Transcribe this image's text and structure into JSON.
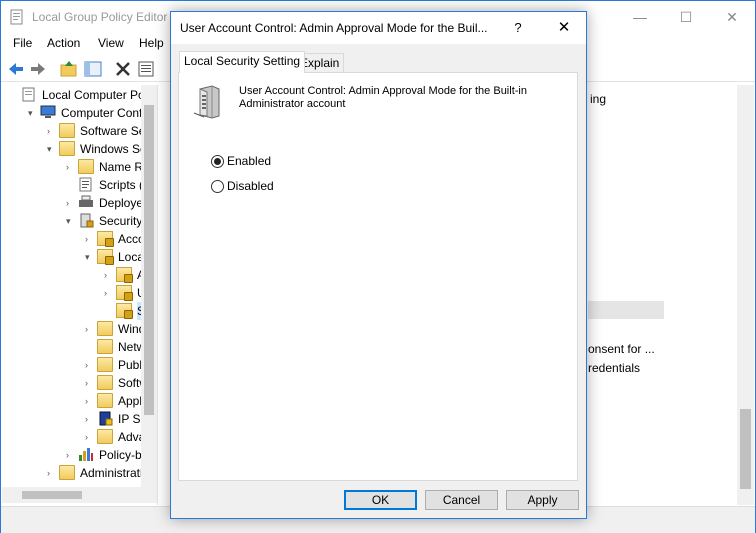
{
  "background_window": {
    "title": "Local Group Policy Editor",
    "controls": {
      "minimize": "—",
      "maximize": "☐",
      "close": "✕"
    },
    "menu": [
      "File",
      "Action",
      "View",
      "Help"
    ],
    "tree": [
      {
        "label": "Local Computer Polic",
        "indent": 0,
        "expander": "",
        "icon": "computer-policy-icon"
      },
      {
        "label": "Computer Config",
        "indent": 1,
        "expander": "▾",
        "icon": "computer-icon"
      },
      {
        "label": "Software Setti",
        "indent": 2,
        "expander": "›",
        "icon": "folder-icon"
      },
      {
        "label": "Windows Sett",
        "indent": 2,
        "expander": "▾",
        "icon": "folder-icon"
      },
      {
        "label": "Name Res",
        "indent": 3,
        "expander": "›",
        "icon": "folder-icon"
      },
      {
        "label": "Scripts (Sta",
        "indent": 3,
        "expander": "",
        "icon": "scripts-icon"
      },
      {
        "label": "Deployed",
        "indent": 3,
        "expander": "›",
        "icon": "printer-icon"
      },
      {
        "label": "Security Se",
        "indent": 3,
        "expander": "▾",
        "icon": "security-icon"
      },
      {
        "label": "Accou",
        "indent": 4,
        "expander": "›",
        "icon": "folder-lock-icon"
      },
      {
        "label": "Local P",
        "indent": 4,
        "expander": "▾",
        "icon": "folder-lock-icon"
      },
      {
        "label": "Au",
        "indent": 5,
        "expander": "›",
        "icon": "folder-lock-icon"
      },
      {
        "label": "Use",
        "indent": 5,
        "expander": "›",
        "icon": "folder-lock-icon"
      },
      {
        "label": "Sec",
        "indent": 5,
        "expander": "",
        "icon": "folder-lock-icon",
        "selected": true
      },
      {
        "label": "Windo",
        "indent": 4,
        "expander": "›",
        "icon": "folder-icon"
      },
      {
        "label": "Netwo",
        "indent": 4,
        "expander": "",
        "icon": "folder-icon"
      },
      {
        "label": "Public",
        "indent": 4,
        "expander": "›",
        "icon": "folder-icon"
      },
      {
        "label": "Softwa",
        "indent": 4,
        "expander": "›",
        "icon": "folder-icon"
      },
      {
        "label": "Applic",
        "indent": 4,
        "expander": "›",
        "icon": "folder-icon"
      },
      {
        "label": "IP Secu",
        "indent": 4,
        "expander": "›",
        "icon": "ip-security-icon"
      },
      {
        "label": "Advan",
        "indent": 4,
        "expander": "›",
        "icon": "folder-icon"
      },
      {
        "label": "Policy-bas",
        "indent": 3,
        "expander": "›",
        "icon": "chart-icon"
      },
      {
        "label": "Administrativ",
        "indent": 2,
        "expander": "›",
        "icon": "folder-icon"
      }
    ],
    "right_pane_fragments": [
      "ing",
      "onsent for ...",
      "redentials"
    ]
  },
  "dialog": {
    "title": "User Account Control: Admin Approval Mode for the Buil...",
    "help_label": "?",
    "close_label": "✕",
    "tabs": [
      "Local Security Setting",
      "Explain"
    ],
    "policy_description": "User Account Control: Admin Approval Mode for the Built-in Administrator account",
    "options": [
      {
        "label": "Enabled",
        "checked": true
      },
      {
        "label": "Disabled",
        "checked": false
      }
    ],
    "buttons": {
      "ok": "OK",
      "cancel": "Cancel",
      "apply": "Apply"
    }
  },
  "colors": {
    "accent_border": "#2b79d6",
    "selection": "#cce8ff",
    "dialog_bg": "#f0f0f0"
  }
}
